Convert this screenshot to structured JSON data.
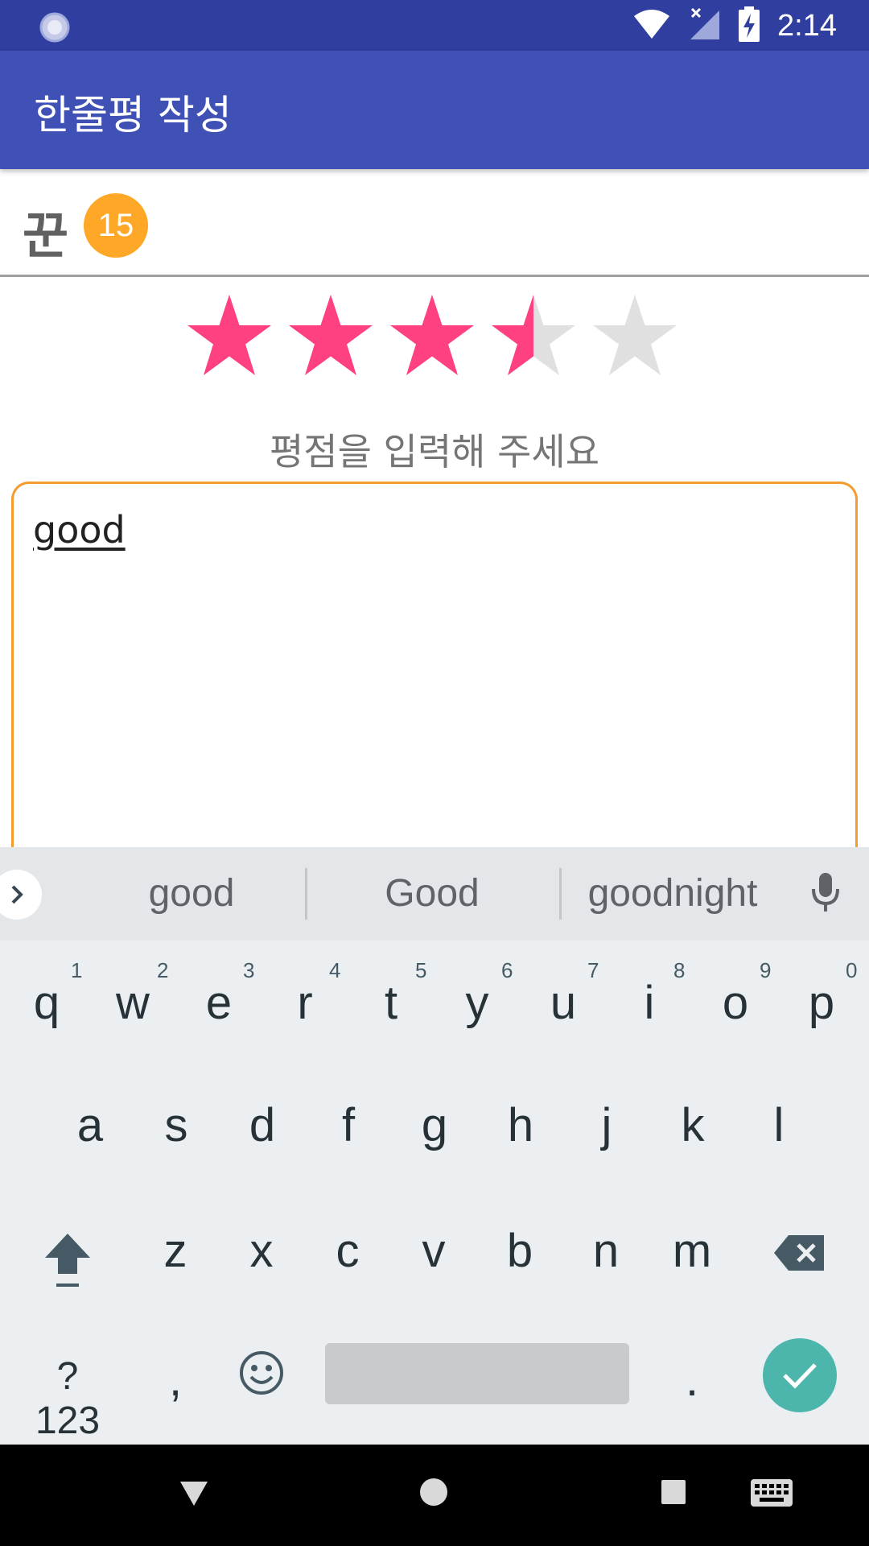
{
  "status_bar": {
    "time": "2:14",
    "icons": [
      "loading-icon",
      "wifi-icon",
      "no-signal-icon",
      "battery-charging-icon"
    ]
  },
  "app_bar": {
    "title": "한줄평 작성"
  },
  "user": {
    "name": "꾼",
    "level": "15"
  },
  "rating": {
    "value": 3.5,
    "max": 5,
    "label": "평점을 입력해 주세요",
    "filled_color": "#ff4081",
    "empty_color": "#e0e0e0"
  },
  "comment": {
    "value": "good",
    "border_color": "#f39c32"
  },
  "keyboard": {
    "suggestions": [
      "good",
      "Good",
      "goodnight"
    ],
    "row1": [
      "q",
      "w",
      "e",
      "r",
      "t",
      "y",
      "u",
      "i",
      "o",
      "p"
    ],
    "row1_hints": [
      "1",
      "2",
      "3",
      "4",
      "5",
      "6",
      "7",
      "8",
      "9",
      "0"
    ],
    "row2": [
      "a",
      "s",
      "d",
      "f",
      "g",
      "h",
      "j",
      "k",
      "l"
    ],
    "row3": [
      "z",
      "x",
      "c",
      "v",
      "b",
      "n",
      "m"
    ],
    "symbols_label": "?123",
    "comma": ",",
    "period": ".",
    "enter_color": "#4db6ac"
  },
  "nav_bar": {
    "icons": [
      "back-icon",
      "home-icon",
      "recents-icon",
      "keyboard-switch-icon"
    ]
  }
}
